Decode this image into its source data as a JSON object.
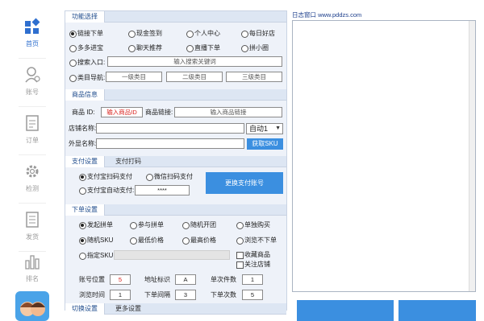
{
  "sidebar": {
    "items": [
      {
        "label": "首页",
        "icon": "dashboard-icon"
      },
      {
        "label": "账号",
        "icon": "user-icon"
      },
      {
        "label": "订单",
        "icon": "order-icon"
      },
      {
        "label": "检测",
        "icon": "gear-icon"
      },
      {
        "label": "发货",
        "icon": "shipping-icon"
      },
      {
        "label": "排名",
        "icon": "ranking-icon"
      }
    ]
  },
  "func": {
    "title": "功能选择",
    "options": [
      "链接下单",
      "现金签到",
      "个人中心",
      "每日好店",
      "多多进宝",
      "聊天推荐",
      "直播下单",
      "拼小圈"
    ],
    "search_label": "搜索入口:",
    "search_placeholder": "输入搜索关键词",
    "category_label": "类目导航:",
    "cat1": "一级类目",
    "cat2": "二级类目",
    "cat3": "三级类目"
  },
  "product": {
    "title": "商品信息",
    "id_label": "商品 ID:",
    "id_value": "输入商品ID",
    "link_label": "商品链接:",
    "link_placeholder": "输入商品链接",
    "shop_label": "店铺名称:",
    "shop_select": "自动1",
    "ext_label": "外显名称:",
    "sku_button": "获取SKU"
  },
  "payment": {
    "tab1": "支付设置",
    "tab2": "支付打码",
    "opt1": "支付宝扫码支付",
    "opt2": "微信扫码支付",
    "opt3": "支付宝自动支付:",
    "password": "****",
    "change_button": "更换支付账号"
  },
  "order": {
    "title": "下单设置",
    "row1": [
      "发起拼单",
      "参与拼单",
      "随机开团",
      "单独购买"
    ],
    "row2": [
      "随机SKU",
      "最低价格",
      "最高价格",
      "浏览不下单"
    ],
    "specify": "指定SKU",
    "chk1": "收藏商品",
    "chk2": "关注店铺",
    "acct_pos_label": "账号位置",
    "acct_pos": "5",
    "addr_label": "地址标识",
    "addr": "A",
    "single_label": "单次件数",
    "single": "1",
    "browse_label": "浏览时间",
    "browse": "1",
    "interval_label": "下单间隔",
    "interval": "3",
    "times_label": "下单次数",
    "times": "5"
  },
  "bottom_tabs": {
    "tab1": "切换设置",
    "tab2": "更多设置"
  },
  "log": {
    "title": "日志窗口 www.pddzs.com"
  }
}
